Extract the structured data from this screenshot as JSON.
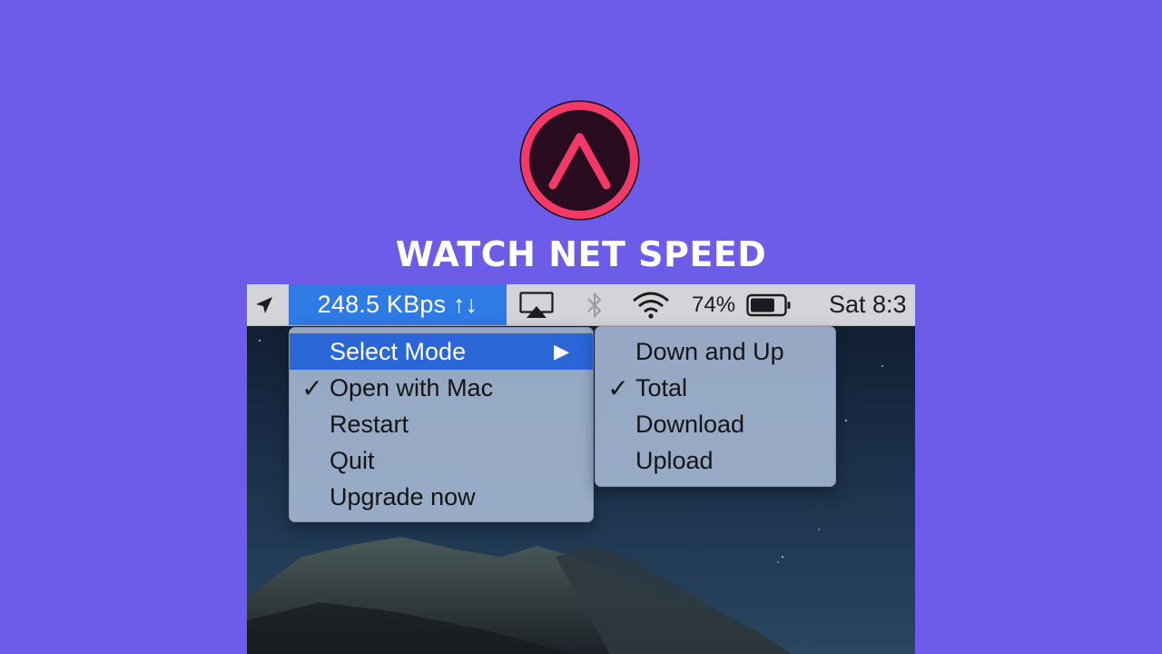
{
  "banner": {
    "title": "WATCH NET SPEED",
    "logo_icon": "chevron-up-circle-logo",
    "background_color": "#6c5ce7",
    "logo_ring_color": "#f13a67",
    "logo_fill_color": "#2a0c20"
  },
  "menubar": {
    "location_icon": "location-arrow-icon",
    "net_speed": "248.5 KBps ↑↓",
    "airplay_icon": "airplay-icon",
    "bluetooth_icon": "bluetooth-icon",
    "wifi_icon": "wifi-icon",
    "battery_percent": "74%",
    "battery_level": 0.74,
    "battery_icon": "battery-icon",
    "clock": "Sat 8:3"
  },
  "main_menu": {
    "items": [
      {
        "label": "Select Mode",
        "checked": false,
        "submenu": true,
        "highlighted": true
      },
      {
        "label": "Open with Mac",
        "checked": true
      },
      {
        "label": "Restart",
        "checked": false
      },
      {
        "label": "Quit",
        "checked": false
      },
      {
        "label": "Upgrade now",
        "checked": false
      }
    ],
    "check_glyph": "✓",
    "submenu_arrow": "▶"
  },
  "submenu": {
    "items": [
      {
        "label": "Down and Up",
        "checked": false
      },
      {
        "label": "Total",
        "checked": true
      },
      {
        "label": "Download",
        "checked": false
      },
      {
        "label": "Upload",
        "checked": false
      }
    ],
    "check_glyph": "✓"
  },
  "colors": {
    "menubar_highlight": "#2f7be6",
    "menu_highlight": "#2a66d6",
    "menu_background": "#a2b4d0"
  }
}
